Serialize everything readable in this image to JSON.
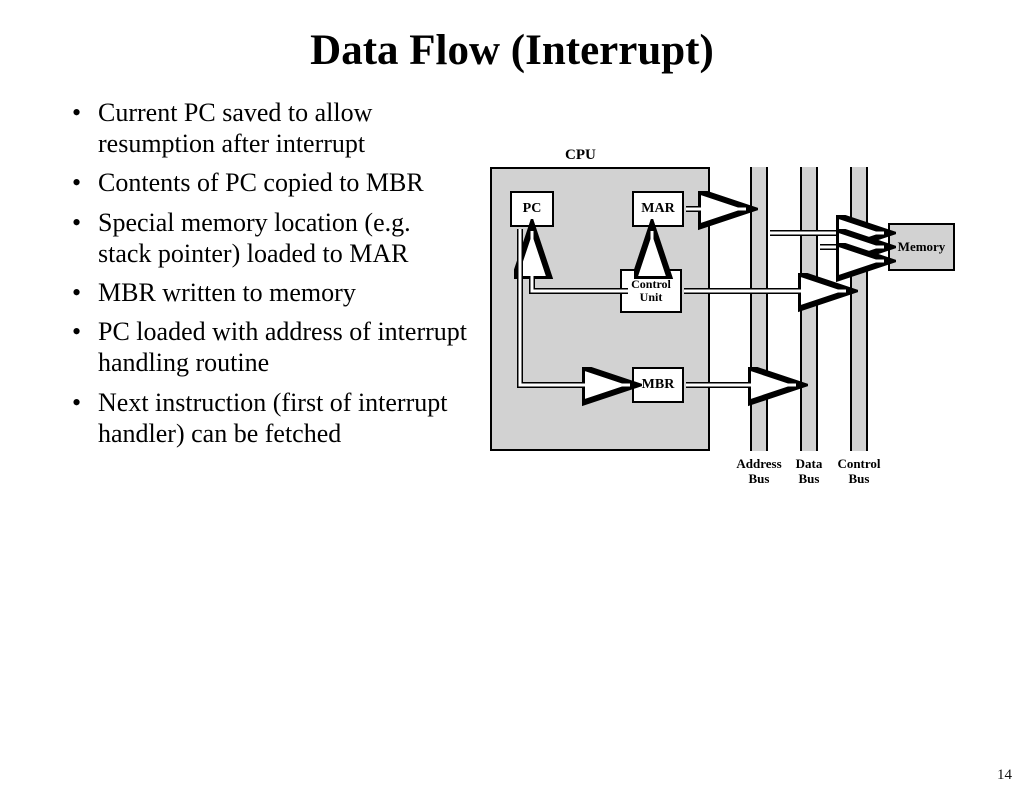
{
  "title": "Data Flow (Interrupt)",
  "bullets": [
    "Current PC saved to allow resumption after interrupt",
    "Contents of PC copied to MBR",
    "Special memory location (e.g. stack pointer) loaded to MAR",
    "MBR written to memory",
    "PC loaded with address of interrupt handling routine",
    "Next instruction (first of interrupt handler) can be fetched"
  ],
  "diagram": {
    "cpu_label": "CPU",
    "pc": "PC",
    "mar": "MAR",
    "control_unit_line1": "Control",
    "control_unit_line2": "Unit",
    "mbr": "MBR",
    "memory": "Memory",
    "address_bus_line1": "Address",
    "address_bus_line2": "Bus",
    "data_bus_line1": "Data",
    "data_bus_line2": "Bus",
    "control_bus_line1": "Control",
    "control_bus_line2": "Bus"
  },
  "page_number": "14"
}
